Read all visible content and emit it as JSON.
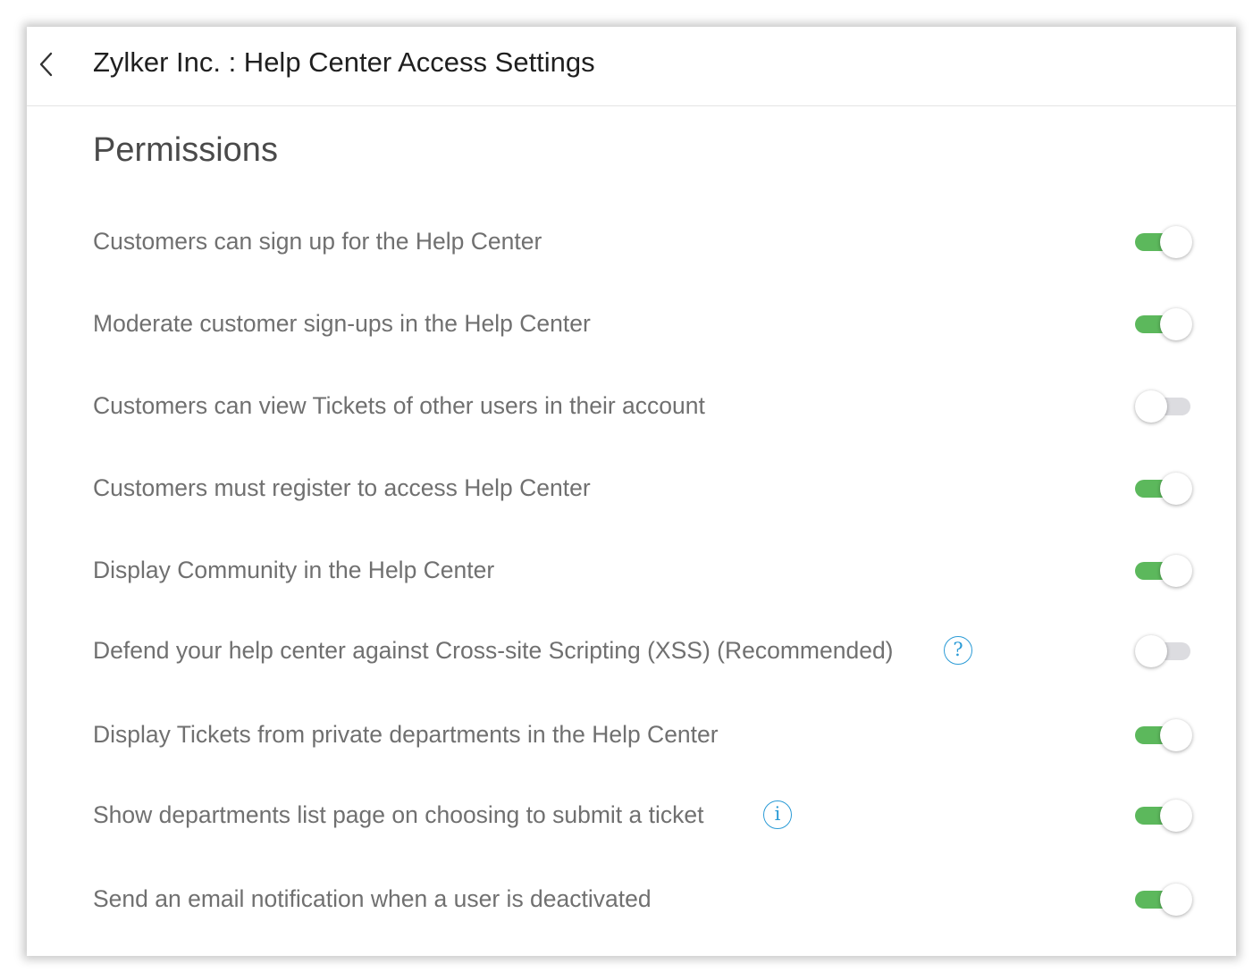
{
  "header": {
    "back_icon": "chevron-left-icon",
    "title": "Zylker Inc. : Help Center Access Settings"
  },
  "permissions": {
    "title": "Permissions",
    "items": [
      {
        "label": "Customers can sign up for the Help Center",
        "enabled": true
      },
      {
        "label": "Moderate customer sign-ups in the Help Center",
        "enabled": true
      },
      {
        "label": "Customers can view Tickets of other users in their account",
        "enabled": false
      },
      {
        "label": "Customers must register to access Help Center",
        "enabled": true
      },
      {
        "label": "Display Community in the Help Center",
        "enabled": true
      },
      {
        "label": "Defend your help center against Cross-site Scripting (XSS) (Recommended)",
        "enabled": false,
        "help_icon": "help-question-icon",
        "help_glyph": "?"
      },
      {
        "label": "Display Tickets from private departments in the Help Center",
        "enabled": true
      },
      {
        "label": "Show departments list page on choosing to submit a ticket",
        "enabled": true,
        "help_icon": "info-icon",
        "help_glyph": "i"
      },
      {
        "label": "Send an email notification when a user is deactivated",
        "enabled": true
      }
    ]
  },
  "colors": {
    "toggle_on": "#5cb85c",
    "toggle_off": "#dcdce0",
    "info_accent": "#2b9bd6"
  }
}
